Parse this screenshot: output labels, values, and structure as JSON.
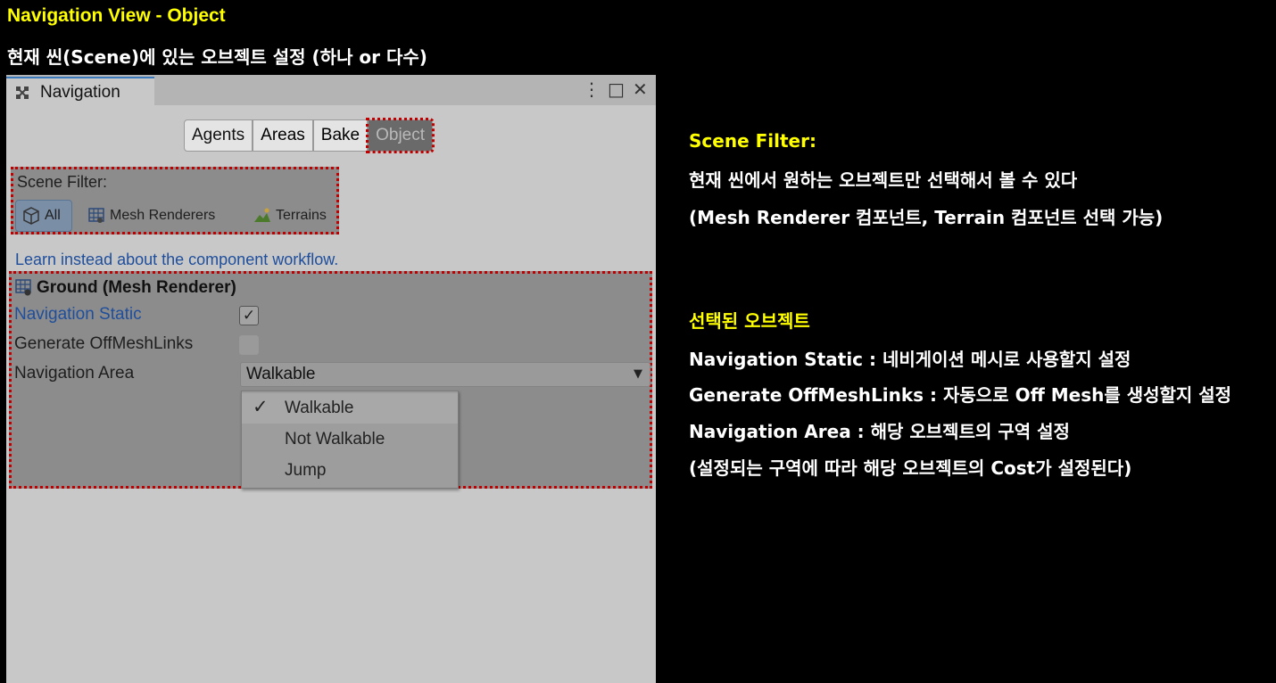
{
  "slide": {
    "title": "Navigation View - Object",
    "subtitle": "현재 씬(Scene)에 있는 오브젝트 설정 (하나 or 다수)"
  },
  "window": {
    "tab_label": "Navigation",
    "tab_icon": "navigation-icon",
    "controls": [
      "⋮",
      "□",
      "✕"
    ]
  },
  "toolbar": {
    "buttons": [
      "Agents",
      "Areas",
      "Bake",
      "Object"
    ],
    "active": "Object"
  },
  "scene_filter": {
    "label": "Scene Filter:",
    "options": [
      "All",
      "Mesh Renderers",
      "Terrains"
    ],
    "selected": "All"
  },
  "learn_link": "Learn instead about the component workflow.",
  "object": {
    "title": "Ground (Mesh Renderer)",
    "navigation_static_label": "Navigation Static",
    "navigation_static_checked": true,
    "generate_offmesh_label": "Generate OffMeshLinks",
    "generate_offmesh_checked": false,
    "navigation_area_label": "Navigation Area",
    "navigation_area_value": "Walkable",
    "area_options": [
      "Walkable",
      "Not Walkable",
      "Jump"
    ]
  },
  "notes": {
    "scene_filter_heading": "Scene Filter:",
    "scene_filter_line1": "현재 씬에서 원하는 오브젝트만 선택해서 볼 수 있다",
    "scene_filter_line2": "(Mesh Renderer 컴포넌트, Terrain 컴포넌트 선택 가능)",
    "selected_heading": "선택된 오브젝트",
    "line_static": "Navigation Static : 네비게이션 메시로 사용할지 설정",
    "line_offmesh": "Generate OffMeshLinks : 자동으로 Off Mesh를 생성할지 설정",
    "line_area": "Navigation Area : 해당 오브젝트의 구역 설정",
    "line_cost": "(설정되는 구역에 따라 해당 오브젝트의 Cost가 설정된다)"
  }
}
